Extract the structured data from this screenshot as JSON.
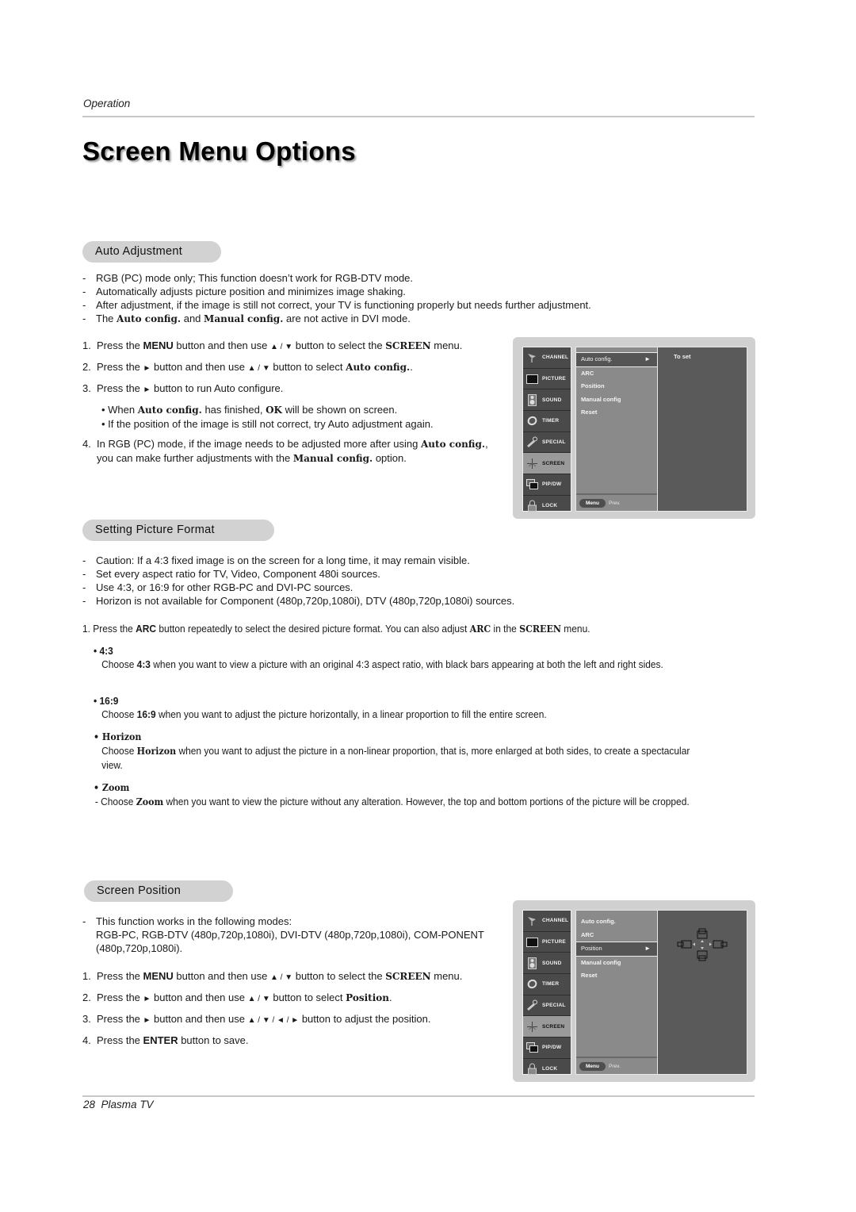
{
  "header": {
    "running_head": "Operation"
  },
  "page_title": "Screen Menu Options",
  "sections": {
    "auto": {
      "title": "Auto Adjustment",
      "notes": [
        "RGB (PC) mode only; This function doesn’t work for RGB-DTV mode.",
        "Automatically adjusts picture position and minimizes image shaking.",
        "After adjustment, if the image is still not correct, your TV is functioning properly but needs further adjustment."
      ],
      "note4": {
        "pre": "The ",
        "b1": "Auto config.",
        "mid": " and ",
        "b2": "Manual config.",
        "post": " are not active in DVI mode."
      },
      "steps": {
        "s1": {
          "num": "1.",
          "pre": "Press the ",
          "b1": "MENU",
          "mid": " button and then use ",
          "arrows": "▲ / ▼",
          "mid2": " button to select the ",
          "b2": "SCREEN",
          "post": " menu."
        },
        "s2": {
          "num": "2.",
          "pre": "Press the ",
          "arrow": "►",
          "mid": " button and then use ",
          "arrows": "▲ / ▼",
          "mid2": " button to select ",
          "b1": "Auto config.",
          "post": "."
        },
        "s3": {
          "num": "3.",
          "pre": "Press the ",
          "arrow": "►",
          "post": " button to run Auto configure."
        },
        "sub1": {
          "pre": "• When ",
          "b1": "Auto config.",
          "mid": " has finished, ",
          "b2": "OK",
          "post": " will be shown on screen."
        },
        "sub2": "• If the position of the image is still not correct, try Auto adjustment again.",
        "s4": {
          "num": "4.",
          "pre": "In RGB (PC) mode, if the image needs to be adjusted more after using ",
          "b1": "Auto config.",
          "mid": ", you can make further adjustments with the ",
          "b2": "Manual config.",
          "post": " option."
        }
      },
      "osd": {
        "sidebar": [
          "CHANNEL",
          "PICTURE",
          "SOUND",
          "TIMER",
          "SPECIAL",
          "SCREEN",
          "PIP/DW",
          "LOCK"
        ],
        "active": "SCREEN",
        "items": [
          "Auto config.",
          "ARC",
          "Position",
          "Manual config",
          "Reset"
        ],
        "selected": "Auto config.",
        "arrow": "►",
        "hint": "To set",
        "footer_button": "Menu",
        "footer_label": "Prev."
      }
    },
    "format": {
      "title": "Setting Picture Format",
      "notes": [
        "Caution: If a 4:3 fixed image is on the screen for a long time, it may remain visible.",
        "Set every aspect ratio for TV, Video, Component 480i sources.",
        "Use 4:3, or 16:9 for other RGB-PC and DVI-PC sources.",
        "Horizon is not available for Component (480p,720p,1080i), DTV (480p,720p,1080i) sources."
      ],
      "step1": {
        "num": "1.",
        "pre": "Press the ",
        "b1": "ARC",
        "mid": " button repeatedly to select the desired picture format. You can also adjust ",
        "b2": "ARC",
        "mid2": " in the ",
        "b3": "SCREEN",
        "post": " menu."
      },
      "options": {
        "o1": {
          "head": "• 4:3",
          "pre": "Choose ",
          "b": "4:3",
          "post": " when you want to view a picture with an original 4:3 aspect ratio, with black bars appearing at both the left and right sides."
        },
        "o2": {
          "head": "• 16:9",
          "pre": "Choose ",
          "b": "16:9",
          "post": " when you want to adjust the picture horizontally, in a linear proportion to fill the entire screen."
        },
        "o3": {
          "head": "• Horizon",
          "pre": "Choose ",
          "b": "Horizon",
          "post": " when you want to adjust the picture in a non-linear proportion, that is, more enlarged at both sides, to create a spectacular view."
        },
        "o4": {
          "head": "• Zoom",
          "pre": "- Choose ",
          "b": "Zoom",
          "post": " when you want to view the picture without any alteration. However, the top and bottom portions of the picture will be cropped."
        }
      }
    },
    "position": {
      "title": "Screen Position",
      "note": "This function works in the following modes:",
      "modes": "RGB-PC, RGB-DTV (480p,720p,1080i), DVI-DTV (480p,720p,1080i), COM-PONENT (480p,720p,1080i).",
      "steps": {
        "s1": {
          "num": "1.",
          "pre": "Press the ",
          "b1": "MENU",
          "mid": " button and then use ",
          "arrows": "▲ / ▼",
          "mid2": " button to select the ",
          "b2": "SCREEN",
          "post": " menu."
        },
        "s2": {
          "num": "2.",
          "pre": "Press the ",
          "arrow": "►",
          "mid": " button and then use ",
          "arrows": "▲ / ▼",
          "mid2": " button to select ",
          "b1": "Position",
          "post": "."
        },
        "s3": {
          "num": "3.",
          "pre": "Press the ",
          "arrow": "►",
          "mid": " button and then use ",
          "arrows": "▲ / ▼ / ◄ / ►",
          "post": " button to adjust the position."
        },
        "s4": {
          "num": "4.",
          "pre": "Press the ",
          "b1": "ENTER",
          "post": " button to save."
        }
      },
      "osd": {
        "sidebar": [
          "CHANNEL",
          "PICTURE",
          "SOUND",
          "TIMER",
          "SPECIAL",
          "SCREEN",
          "PIP/DW",
          "LOCK"
        ],
        "active": "SCREEN",
        "items": [
          "Auto config.",
          "ARC",
          "Position",
          "Manual config",
          "Reset"
        ],
        "selected": "Position",
        "arrow": "►",
        "footer_button": "Menu",
        "footer_label": "Prev."
      }
    }
  },
  "footer": {
    "page_number": "28",
    "product": "Plasma TV"
  }
}
